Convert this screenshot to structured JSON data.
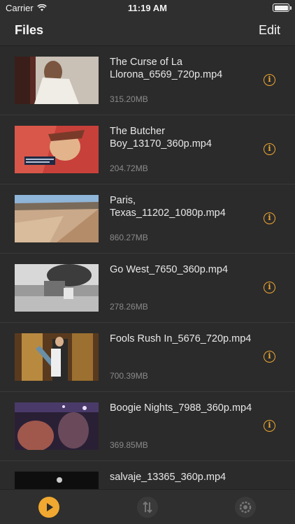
{
  "status_bar": {
    "carrier": "Carrier",
    "time": "11:19 AM"
  },
  "nav": {
    "title": "Files",
    "edit_label": "Edit"
  },
  "files": [
    {
      "title": "The Curse of La Llorona_6569_720p.mp4",
      "size": "315.20MB"
    },
    {
      "title": "The Butcher Boy_13170_360p.mp4",
      "size": "204.72MB"
    },
    {
      "title": "Paris, Texas_11202_1080p.mp4",
      "size": "860.27MB"
    },
    {
      "title": "Go West_7650_360p.mp4",
      "size": "278.26MB"
    },
    {
      "title": "Fools Rush In_5676_720p.mp4",
      "size": "700.39MB"
    },
    {
      "title": "Boogie Nights_7988_360p.mp4",
      "size": "369.85MB"
    },
    {
      "title": "salvaje_13365_360p.mp4",
      "size": ""
    }
  ],
  "tab_bar": {
    "items": [
      "play-icon",
      "transfer-icon",
      "gear-icon"
    ],
    "accent": "#f0a830"
  }
}
